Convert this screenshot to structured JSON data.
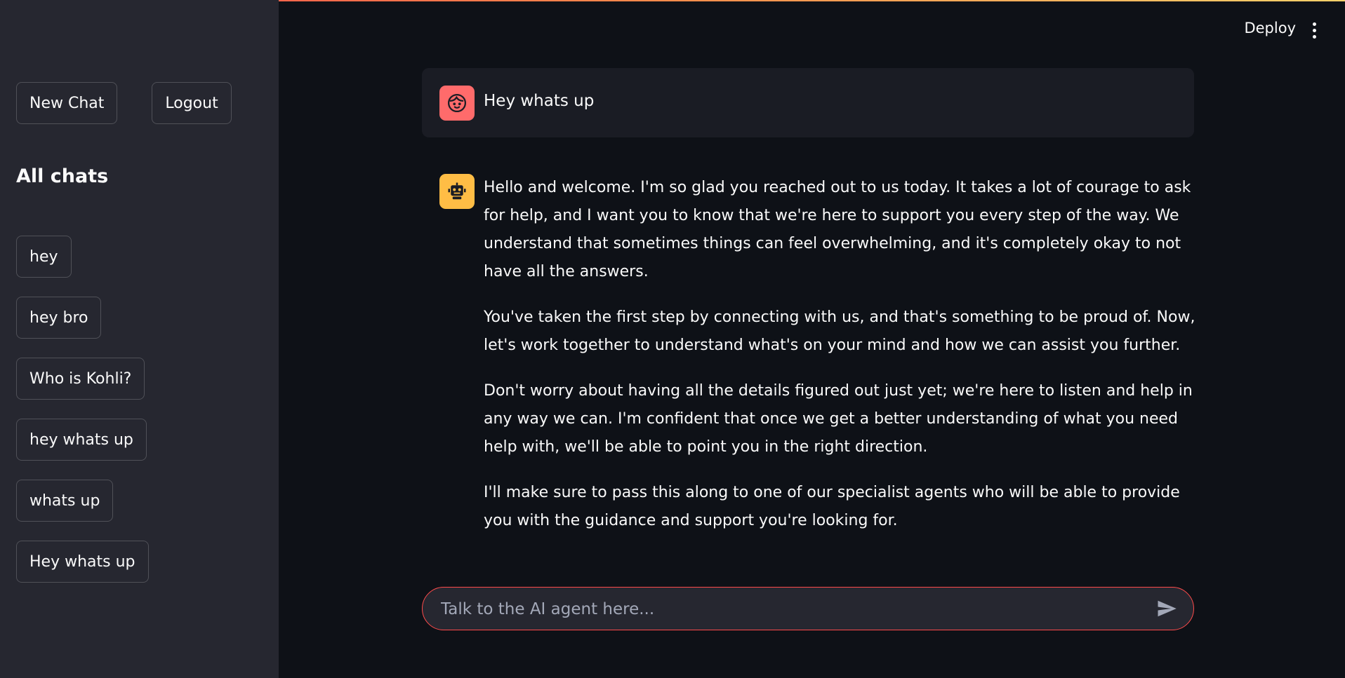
{
  "app": {
    "deploy_label": "Deploy",
    "menu_icon": "kebab-menu-icon"
  },
  "sidebar": {
    "new_chat_label": "New Chat",
    "logout_label": "Logout",
    "all_chats_title": "All chats",
    "chats": [
      {
        "label": "hey"
      },
      {
        "label": "hey bro"
      },
      {
        "label": "Who is Kohli?"
      },
      {
        "label": "hey whats up"
      },
      {
        "label": "whats up"
      },
      {
        "label": "Hey whats up"
      }
    ]
  },
  "conversation": {
    "user_message": "Hey whats up",
    "assistant_paragraphs": [
      "Hello and welcome. I'm so glad you reached out to us today. It takes a lot of courage to ask for help, and I want you to know that we're here to support you every step of the way. We understand that sometimes things can feel overwhelming, and it's completely okay to not have all the answers.",
      "You've taken the first step by connecting with us, and that's something to be proud of. Now, let's work together to understand what's on your mind and how we can assist you further.",
      "Don't worry about having all the details figured out just yet; we're here to listen and help in any way we can. I'm confident that once we get a better understanding of what you need help with, we'll be able to point you in the right direction.",
      "I'll make sure to pass this along to one of our specialist agents who will be able to provide you with the guidance and support you're looking for."
    ]
  },
  "input": {
    "placeholder": "Talk to the AI agent here...",
    "value": "",
    "send_icon": "send-icon"
  },
  "colors": {
    "background": "#0e1117",
    "sidebar": "#262730",
    "accent": "#ff4b4b",
    "user_avatar": "#ff6b6b",
    "bot_avatar": "#ffbd45"
  }
}
